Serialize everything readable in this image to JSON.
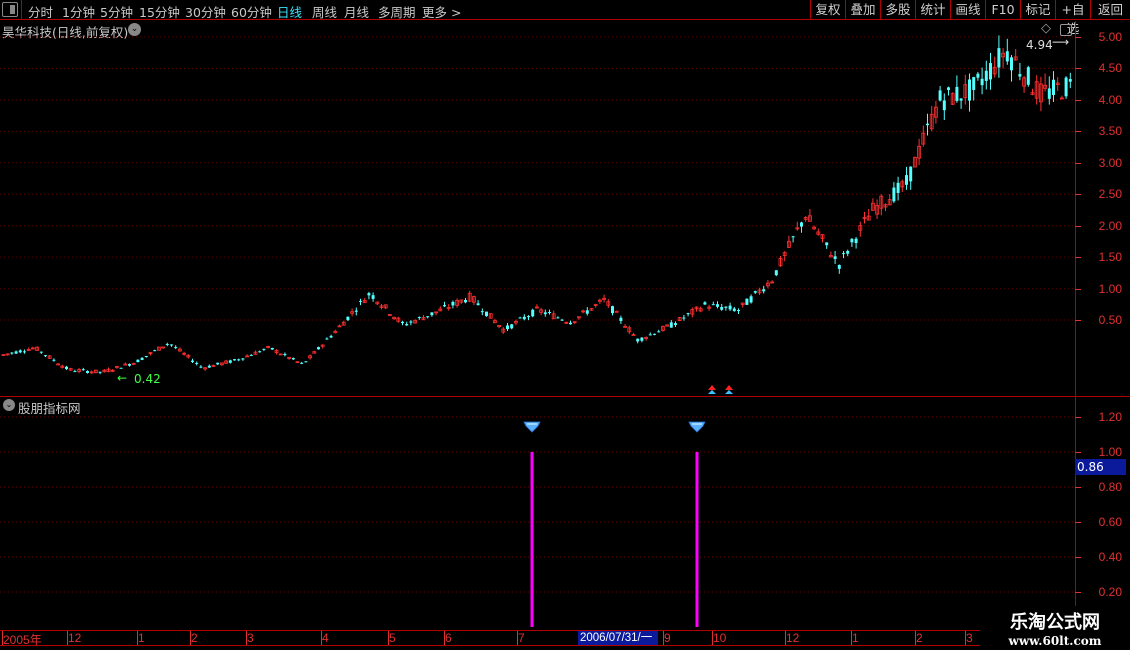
{
  "toolbar": {
    "tabs": [
      "分时",
      "1分钟",
      "5分钟",
      "15分钟",
      "30分钟",
      "60分钟",
      "日线",
      "周线",
      "月线",
      "多周期",
      "更多 >"
    ],
    "active_tab": "日线",
    "right_buttons": [
      "复权",
      "叠加",
      "多股",
      "统计",
      "画线",
      "F10",
      "标记",
      "+自选",
      "返回"
    ]
  },
  "main_chart": {
    "title": "昊华科技(日线,前复权)",
    "max_label": "4.94",
    "min_label": "0.42",
    "y_ticks": [
      "5.00",
      "4.50",
      "4.00",
      "3.50",
      "3.00",
      "2.50",
      "2.00",
      "1.50",
      "1.00",
      "0.50"
    ],
    "price_path": [
      -0.06,
      0.06,
      -0.29,
      -0.33,
      -0.17,
      0.14,
      -0.26,
      -0.14,
      0.06,
      -0.21,
      0.34,
      0.93,
      0.42,
      0.63,
      0.87,
      0.34,
      0.66,
      0.47,
      0.82,
      0.18,
      0.42,
      0.74,
      0.66,
      1.14,
      2.17,
      1.38,
      2.25,
      2.65,
      4.0,
      4.16,
      4.79,
      4.08,
      4.24
    ],
    "up_color": "#ff3030",
    "down_color": "#54ffff"
  },
  "indicator": {
    "title": "股朋指标网",
    "y_ticks": [
      "1.20",
      "1.00",
      "0.80",
      "0.60",
      "0.40",
      "0.20"
    ],
    "current_value": "0.86",
    "signal_values": [
      1,
      1
    ],
    "signal_icon": "diamond-icon",
    "bar_color": "#ff00ff"
  },
  "time_axis": {
    "labels": [
      "2005年",
      "12",
      "1",
      "2",
      "3",
      "4",
      "5",
      "6",
      "7",
      "9",
      "10",
      "12",
      "1",
      "2",
      "3"
    ],
    "cursor_date": "2006/07/31/一"
  },
  "watermark": {
    "line1": "乐淘公式网",
    "line2": "www.60lt.com"
  }
}
